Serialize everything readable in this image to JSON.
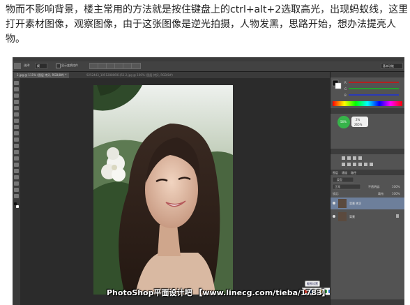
{
  "article": {
    "lines": [
      "物而不影响背景，楼主常用的方法就是按住键盘上的ctrl+alt+2选取高光，出现蚂蚁线，这里",
      "打开素材图像，观察图像，由于这张图像是逆光拍摄，人物发黑，思路开始，想办法提亮人",
      "物。"
    ]
  },
  "photoshop": {
    "options_bar": {
      "tool_label": "选择:",
      "mode_value": "模",
      "sample_all_label": "显示变换控件",
      "right_field": "基本功能"
    },
    "tabs": [
      {
        "label": "2.jpg @ 111% (图层 拷贝, RGB/8#) *"
      },
      {
        "label": "9252443_10512880691(51.2.jpg @ 100% (图层 拷贝, RGB/8#)"
      }
    ],
    "color_panel": {
      "labels": [
        "R",
        "G",
        "B"
      ],
      "values": [
        "",
        "",
        ""
      ]
    },
    "adjust_popup": {
      "percent_main": "56%",
      "percent_a": "2%",
      "percent_b": "265%"
    },
    "layers_panel": {
      "tabs": [
        "图层",
        "通道",
        "路径"
      ],
      "kind_label": "类型",
      "blend_mode": "正常",
      "opacity_label": "不透明度:",
      "opacity_value": "100%",
      "lock_label": "锁定:",
      "fill_label": "填充:",
      "fill_value": "100%",
      "layers": [
        {
          "name": "背景 拷贝",
          "selected": true
        },
        {
          "name": "背景",
          "selected": false
        }
      ]
    },
    "watermark": "PhotoShop平面设计吧  【www.linecg.com/tieba/1783】",
    "floating_toolbar_title": "截图设置"
  },
  "colors": {
    "spectrum_stops": [
      "#ff0000",
      "#ffff00",
      "#00ff00",
      "#00ffff",
      "#0000ff",
      "#ff00ff",
      "#ff0000"
    ],
    "green_badge": "#37b34a",
    "selected_layer": "#6d7f9b"
  }
}
